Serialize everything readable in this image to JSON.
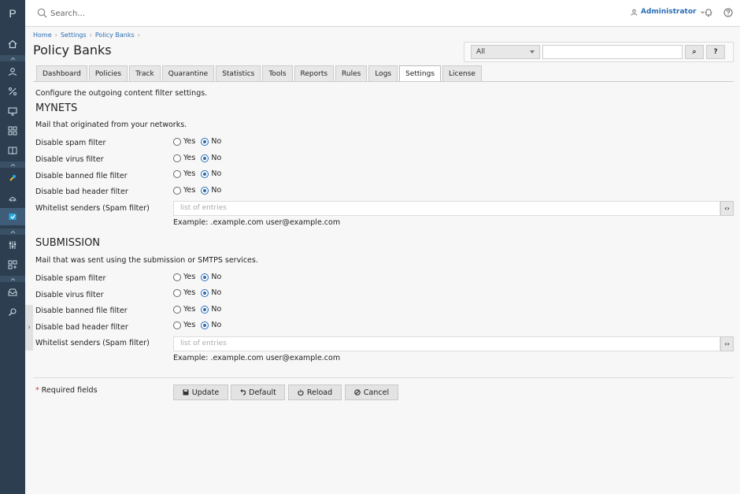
{
  "app": {
    "logo_letter": "P"
  },
  "topbar": {
    "search_placeholder": "Search...",
    "user_label": "Administrator"
  },
  "breadcrumb": [
    "Home",
    "Settings",
    "Policy Banks"
  ],
  "page_title": "Policy Banks",
  "filter": {
    "select_value": "All",
    "search_button": "⌕",
    "help_button": "?"
  },
  "tabs": [
    "Dashboard",
    "Policies",
    "Track",
    "Quarantine",
    "Statistics",
    "Tools",
    "Reports",
    "Rules",
    "Logs",
    "Settings",
    "License"
  ],
  "active_tab": "Settings",
  "intro": "Configure the outgoing content filter settings.",
  "sections": [
    {
      "title": "MYNETS",
      "description": "Mail that originated from your networks.",
      "rows": [
        {
          "label": "Disable spam filter",
          "yes": "Yes",
          "no": "No",
          "value": "No"
        },
        {
          "label": "Disable virus filter",
          "yes": "Yes",
          "no": "No",
          "value": "No"
        },
        {
          "label": "Disable banned file filter",
          "yes": "Yes",
          "no": "No",
          "value": "No"
        },
        {
          "label": "Disable bad header filter",
          "yes": "Yes",
          "no": "No",
          "value": "No"
        }
      ],
      "whitelist_label": "Whitelist senders (Spam filter)",
      "whitelist_placeholder": "list of entries",
      "example": "Example: .example.com user@example.com"
    },
    {
      "title": "SUBMISSION",
      "description": "Mail that was sent using the submission or SMTPS services.",
      "rows": [
        {
          "label": "Disable spam filter",
          "yes": "Yes",
          "no": "No",
          "value": "No"
        },
        {
          "label": "Disable virus filter",
          "yes": "Yes",
          "no": "No",
          "value": "No"
        },
        {
          "label": "Disable banned file filter",
          "yes": "Yes",
          "no": "No",
          "value": "No"
        },
        {
          "label": "Disable bad header filter",
          "yes": "Yes",
          "no": "No",
          "value": "No"
        }
      ],
      "whitelist_label": "Whitelist senders (Spam filter)",
      "whitelist_placeholder": "list of entries",
      "example": "Example: .example.com user@example.com"
    }
  ],
  "footer": {
    "required_star": "*",
    "required_text": "Required fields",
    "buttons": {
      "update": "Update",
      "default": "Default",
      "reload": "Reload",
      "cancel": "Cancel"
    }
  },
  "colors": {
    "sidebar": "#2c3e50",
    "accent": "#2a6db5",
    "sidebar_active_icon": "#27a9e1",
    "sidebar_highlight_icon": "#f0b429"
  }
}
